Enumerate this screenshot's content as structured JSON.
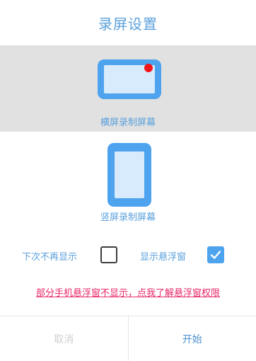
{
  "dialog": {
    "title": "录屏设置",
    "options": [
      {
        "label": "横屏录制屏幕",
        "icon": "landscape-screen-icon",
        "selected": true
      },
      {
        "label": "竖屏录制屏幕",
        "icon": "portrait-screen-icon",
        "selected": false
      }
    ],
    "checkboxes": [
      {
        "label": "下次不再显示",
        "checked": false
      },
      {
        "label": "显示悬浮窗",
        "checked": true
      }
    ],
    "link_text": "部分手机悬浮窗不显示，点我了解悬浮窗权限",
    "buttons": {
      "cancel": "取消",
      "start": "开始"
    }
  },
  "colors": {
    "accent": "#5aa0dc",
    "icon_blue": "#4ea3ee",
    "record_dot": "#f2151c",
    "link": "#e8286a",
    "selected_bg": "#e1e1e1"
  }
}
